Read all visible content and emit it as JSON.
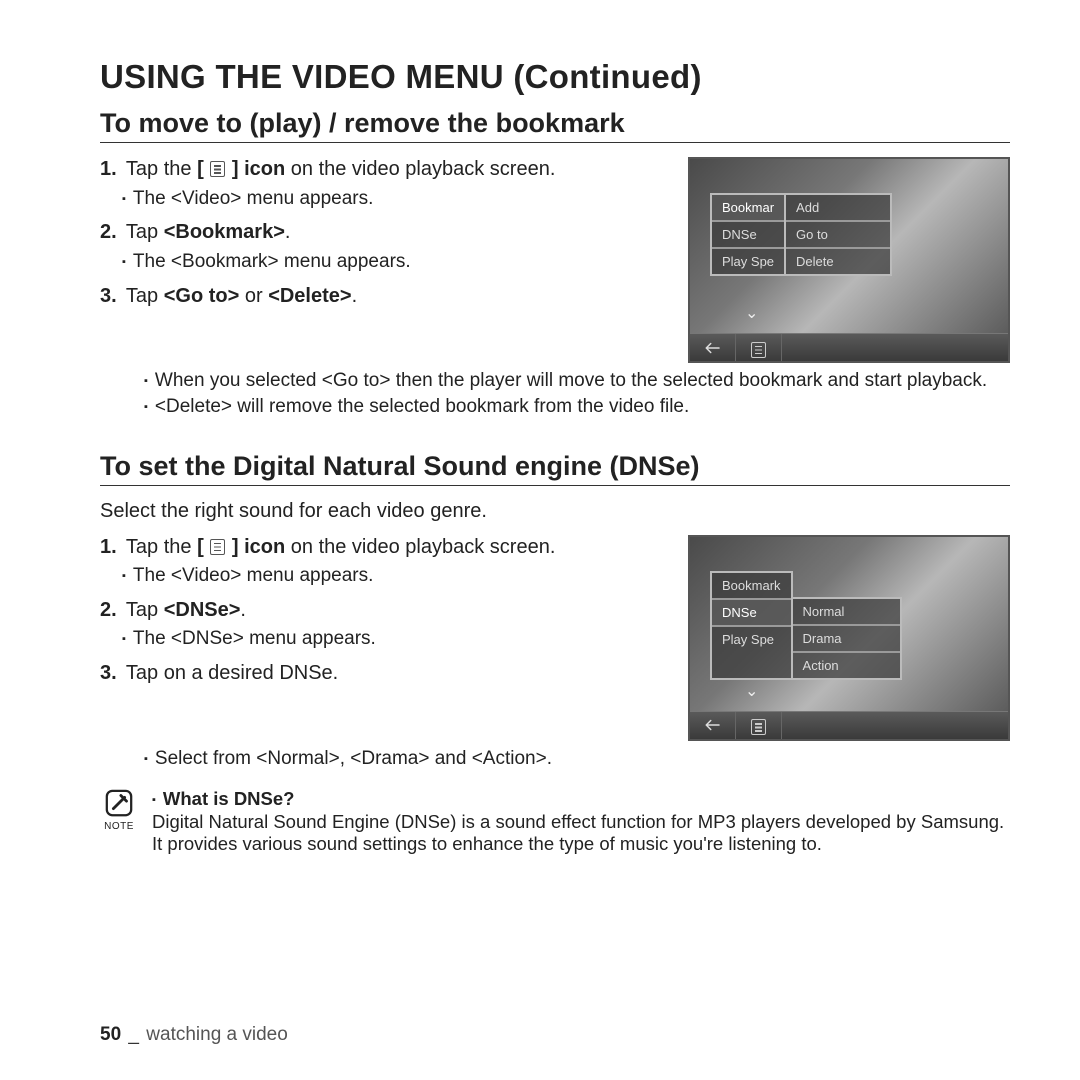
{
  "title": "USING THE VIDEO MENU (Continued)",
  "section1": {
    "subtitle": "To move to (play) / remove the bookmark",
    "step1_a": "Tap the ",
    "step1_b": " icon",
    "step1_c": " on the video playback screen.",
    "step1_sub": "The <Video> menu appears.",
    "step2_a": "Tap ",
    "step2_b": "<Bookmark>",
    "step2_c": ".",
    "step2_sub": "The <Bookmark> menu appears.",
    "step3_a": "Tap ",
    "step3_b": "<Go to>",
    "step3_c": " or ",
    "step3_d": "<Delete>",
    "step3_e": ".",
    "step3_sub1": "When you selected <Go to> then the player will move to the selected bookmark and start playback.",
    "step3_sub2": "<Delete> will remove the selected bookmark from the video file.",
    "device": {
      "left": [
        "Bookmar",
        "DNSe",
        "Play Spe"
      ],
      "right": [
        "Add",
        "Go to",
        "Delete"
      ]
    }
  },
  "section2": {
    "subtitle": "To set the Digital Natural Sound engine (DNSe)",
    "intro": "Select the right sound for each video genre.",
    "step1_a": "Tap the ",
    "step1_b": " icon",
    "step1_c": " on the video playback screen.",
    "step1_sub": "The <Video> menu appears.",
    "step2_a": "Tap ",
    "step2_b": "<DNSe>",
    "step2_c": ".",
    "step2_sub": "The <DNSe> menu appears.",
    "step3": "Tap on a desired DNSe.",
    "step3_sub": "Select from <Normal>, <Drama> and <Action>.",
    "device": {
      "left": [
        "Bookmark",
        "DNSe",
        "Play Spe"
      ],
      "right": [
        "Normal",
        "Drama",
        "Action"
      ]
    }
  },
  "note": {
    "icon_label": "NOTE",
    "question": "What is DNSe?",
    "answer": "Digital Natural Sound Engine (DNSe) is a sound effect function for MP3 players developed by Samsung. It provides various sound settings to enhance the type of music you're listening to."
  },
  "footer": {
    "page": "50",
    "sep": "_",
    "section": "watching a video"
  },
  "labels": {
    "n1": "1.",
    "n2": "2.",
    "n3": "3.",
    "bracket_l": "[",
    "bracket_r": "]"
  }
}
